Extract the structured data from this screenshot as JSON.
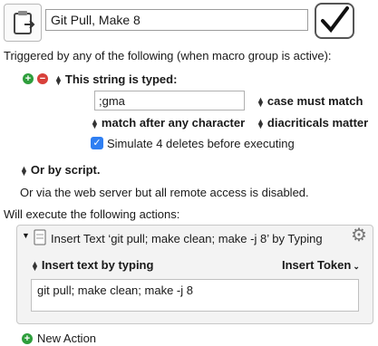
{
  "header": {
    "macro_name": "Git Pull, Make 8",
    "enabled_icon": "checkmark-icon",
    "macro_icon": "clipboard-icon"
  },
  "trigger": {
    "heading": "Triggered by any of the following (when macro group is active):",
    "type_label": "This string is typed:",
    "string_value": ";gma",
    "case_option": "case must match",
    "match_option": "match after any character",
    "diacriticals_option": "diacriticals matter",
    "simulate_label": "Simulate 4 deletes before executing",
    "simulate_checked": true,
    "or_script": "Or by script.",
    "web_server_text": "Or via the web server but all remote access is disabled."
  },
  "actions": {
    "heading": "Will execute the following actions:",
    "action_title": "Insert Text ‘git pull; make clean; make -j 8’ by Typing",
    "insert_mode": "Insert text by typing",
    "insert_token": "Insert Token",
    "text_value": "git pull; make clean; make -j 8",
    "new_action": "New Action"
  },
  "colors": {
    "add_green": "#2e9e3c",
    "remove_red": "#d8403a",
    "checkbox_blue": "#2f7ff2"
  }
}
